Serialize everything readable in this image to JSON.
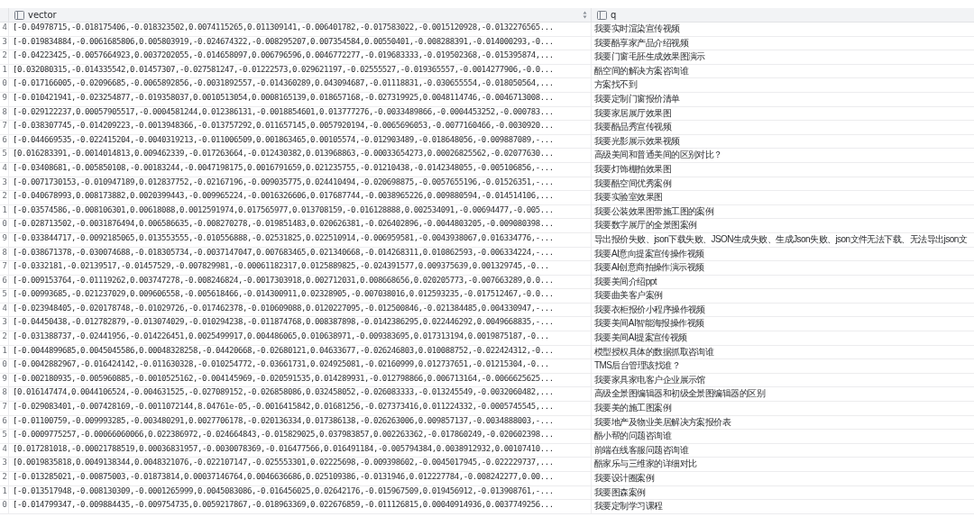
{
  "columns": [
    {
      "label": "vector"
    },
    {
      "label": "q"
    }
  ],
  "rows": [
    {
      "number": "4",
      "vector": "[-0.04978715,-0.018175406,-0.018323502,0.0074115265,0.011309141,-0.006401782,-0.017583022,-0.0015120928,-0.0132276565...",
      "q": "我要实时渲染宣传视频"
    },
    {
      "number": "3",
      "vector": "[-0.019834884,-0.0061685806,0.005803919,-0.024674322,-0.008295207,0.007354584,0.00550401,-0.008288391,-0.014000293,-0...",
      "q": "我要酷享家产品介绍视频"
    },
    {
      "number": "2",
      "vector": "[-0.04223425,-0.0057664923,0.0037202055,-0.014658097,0.006796596,0.0046772277,-0.019683333,-0.019502368,-0.015395874,...",
      "q": "我要门窗毛胚生成效果图演示"
    },
    {
      "number": "1",
      "vector": "[0.032080315,-0.014335542,0.01457307,-0.027581247,-0.01222573,0.029621197,-0.02555527,-0.019365557,-0.0014277906,-0.0...",
      "q": "酷空间的解决方案咨询谁"
    },
    {
      "number": "0",
      "vector": "[-0.017166005,-0.02096685,-0.0065892856,-0.0031892557,-0.014360289,0.043094687,-0.01118831,-0.030655554,-0.018050564,...",
      "q": "方案找不到"
    },
    {
      "number": "9",
      "vector": "[-0.010421941,-0.023254877,-0.019358037,0.0010513054,0.0008165139,0.018657168,-0.027319925,0.0048114746,-0.0046713008...",
      "q": "我要定制门窗报价清单"
    },
    {
      "number": "8",
      "vector": "[-0.029122237,0.00057905517,-0.0004581244,0.012386131,-0.0018854601,0.013777276,-0.0033489866,-0.0004453252,-0.000783...",
      "q": "我要家居展厅效果图"
    },
    {
      "number": "7",
      "vector": "[-0.038307745,-0.014209223,-0.0013948366,-0.013757292,0.011657145,0.0057920194,-0.0065696053,-0.0077160466,-0.0030920...",
      "q": "我要酷品秀宣传视频"
    },
    {
      "number": "6",
      "vector": "[-0.044669535,-0.022415204,-0.0040319213,-0.011006509,0.001863465,0.00105574,-0.012903489,-0.018648056,-0.009887089,-...",
      "q": "我要光影展示效果视频"
    },
    {
      "number": "5",
      "vector": "[0.016283391,-0.0014014813,0.009462339,-0.017263664,-0.012430382,0.013968863,-0.00033654273,0.00026825562,-0.02077630...",
      "q": "高级美间和普通美间的区别对比？"
    },
    {
      "number": "4",
      "vector": "[-0.03408681,-0.005850108,-0.00183244,-0.0047198175,0.0016791659,0.021235755,-0.01210438,-0.0142348055,-0.005106856,-...",
      "q": "我要灯饰棚拍效果图"
    },
    {
      "number": "3",
      "vector": "[-0.0071730153,-0.010947189,0.012837752,-0.02167196,-0.009035775,0.024410494,-0.020698875,-0.0057655196,-0.01526351,-...",
      "q": "我要酷空间优秀案例"
    },
    {
      "number": "2",
      "vector": "[-0.040678993,0.008173882,0.0020399443,-0.009965224,-0.0016326606,0.017687744,-0.0038965226,0.009880594,-0.014514106,...",
      "q": "我要实验室效果图"
    },
    {
      "number": "1",
      "vector": "[-0.03574586,-0.008106301,0.00618088,0.0012591974,0.017565977,0.013708159,-0.016128888,0.002534091,-0.00694477,-0.005...",
      "q": "我要公装效果图带施工图的案例"
    },
    {
      "number": "0",
      "vector": "[-0.028713502,-0.0031876494,0.006586635,-0.008270278,-0.019851483,0.020626381,-0.026402896,-0.0044803205,-0.009080398...",
      "q": "我要数字展厅的全景图案例"
    },
    {
      "number": "9",
      "vector": "[-0.033844717,-0.0092185065,0.013553555,-0.010556888,-0.02531825,0.022510914,-0.006959581,-0.0043938067,0.016334776,-...",
      "q": "导出报价失败、json下载失败、JSON生成失败、生成Json失败、json文件无法下载、无法导出json文"
    },
    {
      "number": "8",
      "vector": "[-0.038671378,-0.030074688,-0.018305734,-0.0037147047,0.007683465,0.021340668,-0.014268311,0.010862593,-0.006334224,-...",
      "q": "我要AI意向提案宣传操作视频"
    },
    {
      "number": "7",
      "vector": "[-0.0332181,-0.02139517,-0.01457529,-0.007829981,-0.00061182317,0.0125889825,-0.024391577,0.009375639,0.001329745,-0...",
      "q": "我要AI创意商拍操作演示视频"
    },
    {
      "number": "6",
      "vector": "[-0.009153764,-0.01119262,0.003747278,-0.008246824,-0.0017303918,0.002712031,0.008668656,0.020205773,-0.007663289,0.0...",
      "q": "我要美间介绍ppt"
    },
    {
      "number": "5",
      "vector": "[-0.00993685,-0.021237029,0.009606558,-0.005618466,-0.014300911,0.02328905,-0.007038016,0.012593235,-0.017512467,-0.0...",
      "q": "我要曲美客户案例"
    },
    {
      "number": "4",
      "vector": "[-0.023948405,-0.020178748,-0.01029726,-0.017462378,-0.010609088,0.0120227095,-0.012500846,-0.021384485,0.004330947,-...",
      "q": "我要衣柜报价小程序操作视频"
    },
    {
      "number": "3",
      "vector": "[-0.04450438,-0.012782879,-0.013074029,-0.010294238,-0.011874768,0.008387898,-0.0142386295,0.022446292,0.0049668835,-...",
      "q": "我要美间AI智能海报操作视频"
    },
    {
      "number": "2",
      "vector": "[-0.031388737,-0.02441956,-0.014226451,0.0025499917,0.004486065,0.010638971,-0.009383695,0.017313194,0.0019875187,-0...",
      "q": "我要美间AI提案宣传视频"
    },
    {
      "number": "1",
      "vector": "[-0.0044899685,0.0045045586,0.00048328258,-0.04420668,-0.02680121,0.04633677,-0.026246803,0.010088752,-0.022424312,-0...",
      "q": "模型授权具体的数据抓取咨询谁"
    },
    {
      "number": "0",
      "vector": "[-0.0042882967,-0.016424142,-0.011630328,-0.010254772,-0.03661731,0.024925081,-0.02160999,0.012737651,-0.01215304,-0...",
      "q": "TMS后台管理该找谁？"
    },
    {
      "number": "9",
      "vector": "[-0.002180935,-0.005960885,-0.0010525162,-0.004145969,-0.020591535,0.014289931,-0.012798866,0.006713164,-0.0066625625...",
      "q": "我要家具家电客户企业展示馆"
    },
    {
      "number": "8",
      "vector": "[0.016147474,0.0044106524,-0.004631525,-0.027089152,-0.026858086,0.032458052,-0.026083333,-0.013245549,-0.0032060482,...",
      "q": "高级全景图编辑器和初级全景图编辑器的区别"
    },
    {
      "number": "7",
      "vector": "[-0.029083401,-0.007428169,-0.0011072144,8.04761e-05,-0.0016415842,0.01681256,-0.027373416,0.011224332,-0.0005745545,...",
      "q": "我要美的施工图案例"
    },
    {
      "number": "6",
      "vector": "[-0.01100759,-0.009993285,-0.003480291,0.0027706178,-0.020136334,0.017386138,-0.026263006,0.009857137,-0.0034888003,-...",
      "q": "我要地产及物业美居解决方案报价表"
    },
    {
      "number": "5",
      "vector": "[-0.0009775257,-0.00066060066,0.022386972,-0.024664843,-0.015829025,0.037983857,0.002263362,-0.017860249,-0.020602398...",
      "q": "酷小帮的问题咨询谁"
    },
    {
      "number": "4",
      "vector": "[0.017281018,-0.00021788519,0.00036831957,-0.0030078369,-0.016477566,0.016491184,-0.005794384,0.0038912932,0.00107410...",
      "q": "前端在线客服问题咨询谁"
    },
    {
      "number": "3",
      "vector": "[0.0019835818,0.0049138344,0.0048321076,-0.022107147,-0.025553301,0.02225698,-0.009398602,-0.0045017945,-0.022229737,...",
      "q": "酷家乐与三维家的详细对比"
    },
    {
      "number": "2",
      "vector": "[-0.013285021,-0.00875003,-0.01873814,0.00037146764,0.0046636686,0.025109386,-0.0131946,0.012227784,-0.008242277,0.00...",
      "q": "我要设计圈案例"
    },
    {
      "number": "1",
      "vector": "[-0.013517948,-0.008130309,-0.0001265999,0.0045083086,-0.016456025,0.02642176,-0.015967509,0.019456912,-0.013908761,-...",
      "q": "我要图森案例"
    },
    {
      "number": "0",
      "vector": "[-0.014799347,-0.009884435,-0.009754735,0.0059217867,-0.018963369,0.022676859,-0.011126815,0.00040914936,0.0037749256...",
      "q": "我要定制学习课程"
    }
  ]
}
